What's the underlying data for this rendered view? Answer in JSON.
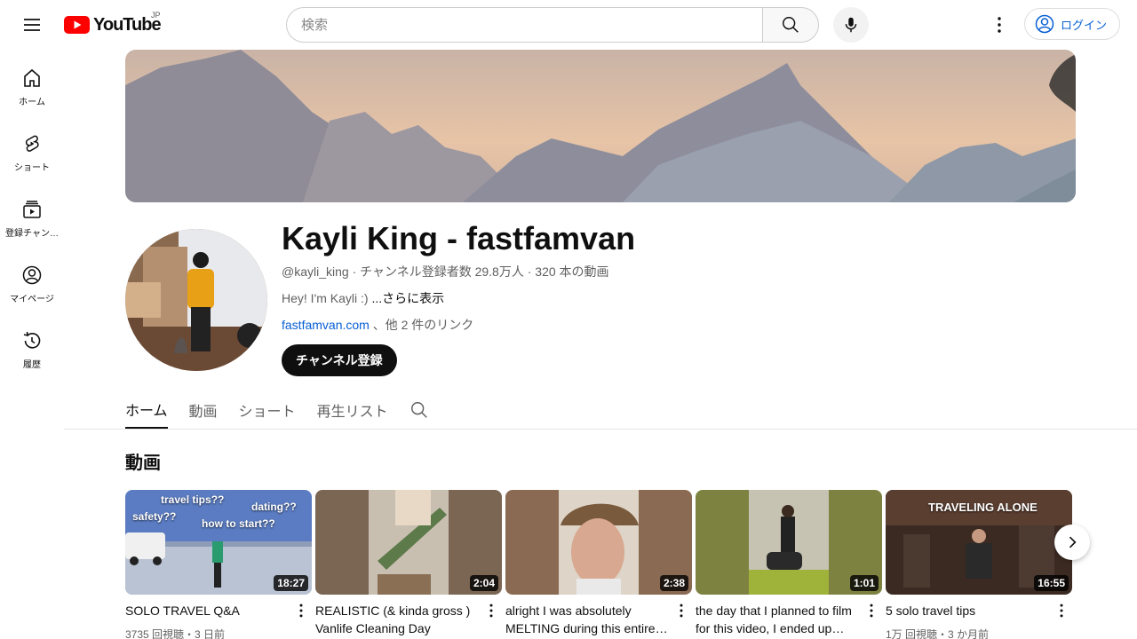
{
  "header": {
    "logo_text": "YouTube",
    "logo_region": "JP",
    "search_placeholder": "検索",
    "login_label": "ログイン"
  },
  "sidebar": {
    "items": [
      {
        "label": "ホーム",
        "icon": "home-icon"
      },
      {
        "label": "ショート",
        "icon": "shorts-icon"
      },
      {
        "label": "登録チャン…",
        "icon": "subscriptions-icon"
      },
      {
        "label": "マイページ",
        "icon": "account-icon"
      },
      {
        "label": "履歴",
        "icon": "history-icon"
      }
    ]
  },
  "channel": {
    "name": "Kayli King - fastfamvan",
    "meta": "@kayli_king · チャンネル登録者数 29.8万人 · 320 本の動画",
    "description": "Hey! I'm Kayli :) ",
    "description_more": "...さらに表示",
    "link": "fastfamvan.com",
    "links_more": " 、他 2 件のリンク",
    "subscribe_label": "チャンネル登録"
  },
  "tabs": [
    "ホーム",
    "動画",
    "ショート",
    "再生リスト"
  ],
  "section": {
    "title": "動画"
  },
  "videos": [
    {
      "title": "SOLO TRAVEL Q&A",
      "meta": "3735 回視聴・3 日前",
      "duration": "18:27",
      "overlay": [
        "travel tips??",
        "dating??",
        "safety??",
        "how to start??"
      ]
    },
    {
      "title": "REALISTIC (& kinda gross ) Vanlife Cleaning Day",
      "meta": "",
      "duration": "2:04"
    },
    {
      "title": "alright I was absolutely MELTING during this entire…",
      "meta": "",
      "duration": "2:38"
    },
    {
      "title": "the day that I planned to film for this video, I ended up…",
      "meta": "",
      "duration": "1:01"
    },
    {
      "title": "5 solo travel tips",
      "meta": "1万 回視聴・3 か月前",
      "duration": "16:55",
      "overlay": [
        "TRAVELING ALONE"
      ]
    }
  ],
  "colors": {
    "brand_red": "#ff0000",
    "link_blue": "#065fd4",
    "text_primary": "#0f0f0f",
    "text_secondary": "#606060"
  }
}
